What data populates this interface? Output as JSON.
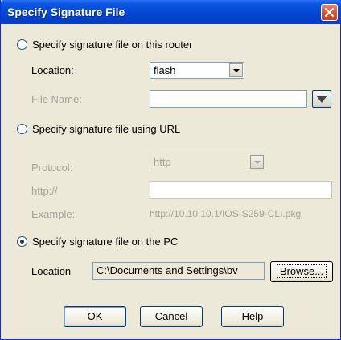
{
  "window": {
    "title": "Specify Signature File",
    "close_label": "close"
  },
  "router_section": {
    "radio_label": "Specify signature file on this router",
    "location_label": "Location:",
    "location_value": "flash",
    "file_name_label": "File Name:",
    "file_name_value": ""
  },
  "url_section": {
    "radio_label": "Specify signature file using URL",
    "protocol_label": "Protocol:",
    "protocol_value": "http",
    "url_prefix_label": "http://",
    "url_value": "",
    "example_label": "Example:",
    "example_value": "http://10.10.10.1/IOS-S259-CLI.pkg"
  },
  "pc_section": {
    "radio_label": "Specify signature file on the PC",
    "location_label": "Location",
    "location_value": "C:\\Documents and Settings\\bv",
    "browse_label": "Browse..."
  },
  "buttons": {
    "ok": "OK",
    "cancel": "Cancel",
    "help": "Help"
  },
  "selected_option": "pc"
}
